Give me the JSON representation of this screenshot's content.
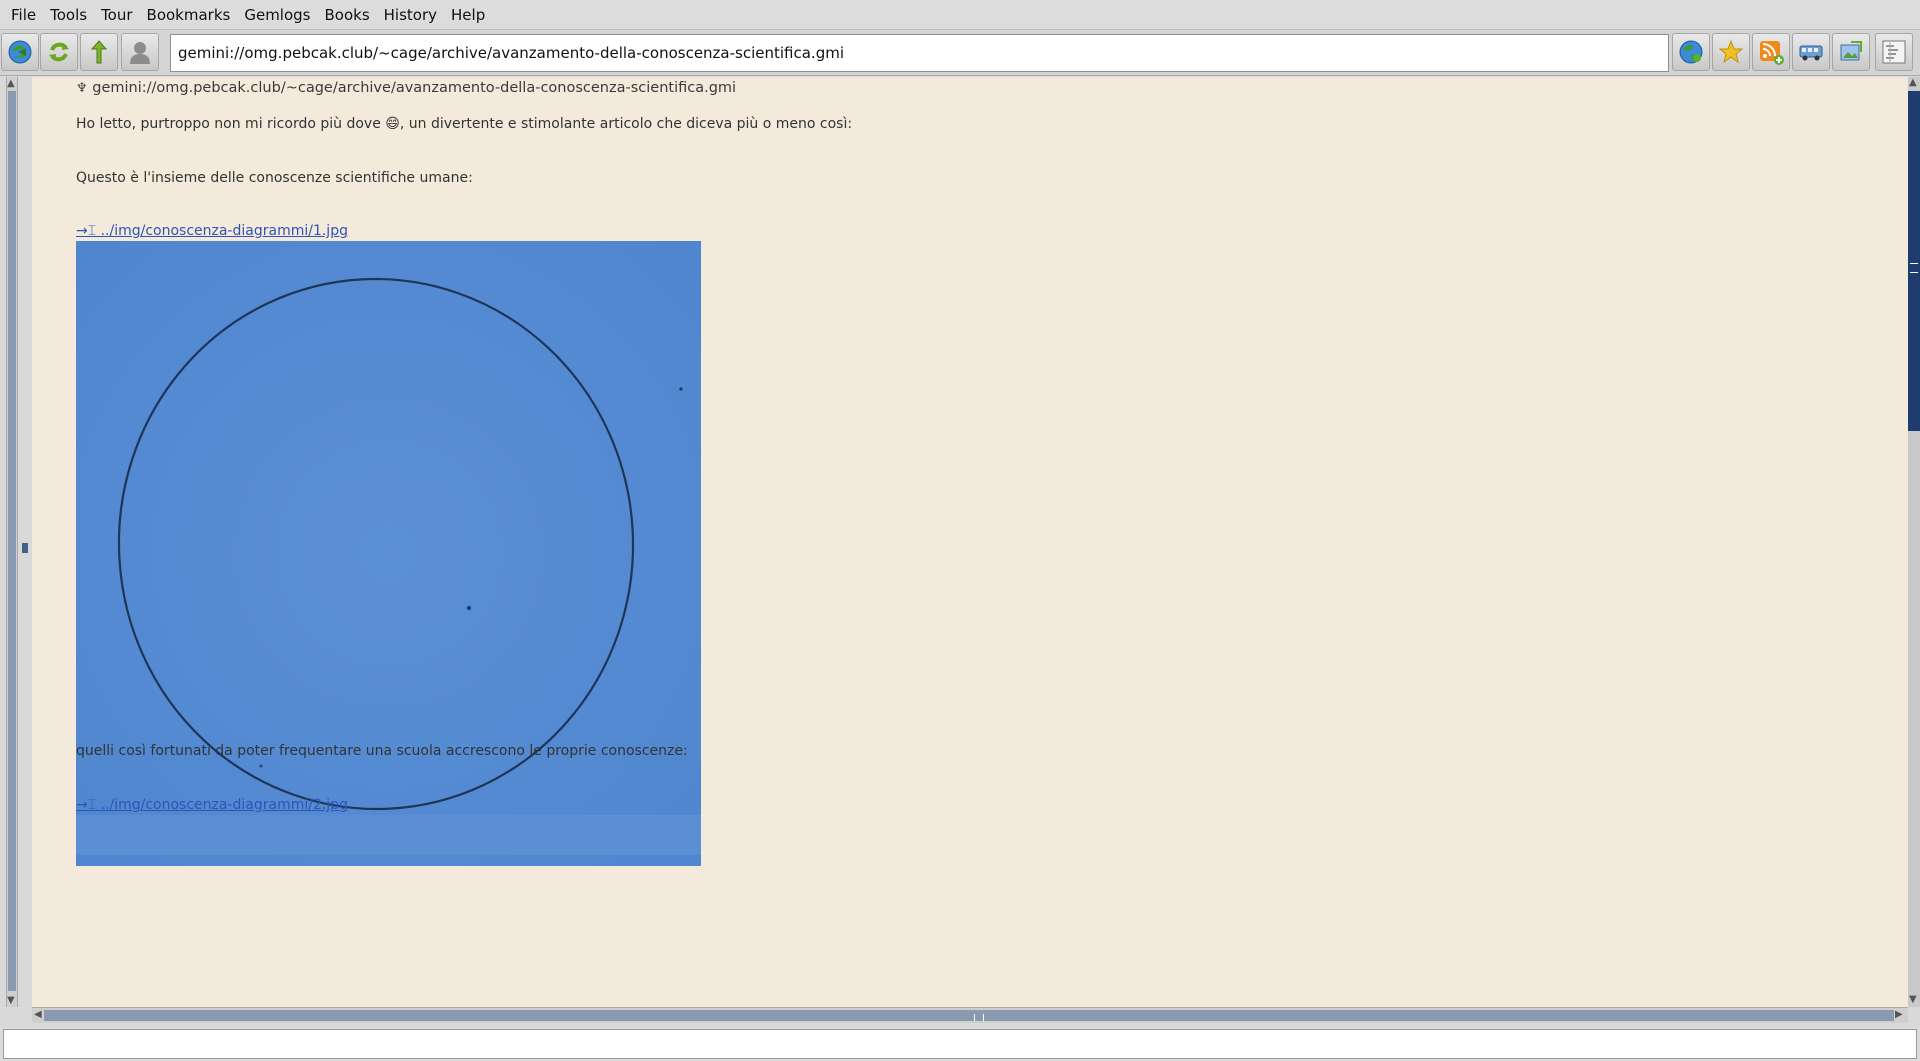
{
  "menu": [
    "File",
    "Tools",
    "Tour",
    "Bookmarks",
    "Gemlogs",
    "Books",
    "History",
    "Help"
  ],
  "toolbar": {
    "address": "gemini://omg.pebcak.club/~cage/archive/avanzamento-della-conoscenza-scientifica.gmi",
    "left_icons": [
      "back-icon",
      "reload-icon",
      "up-icon",
      "identity-icon"
    ],
    "right_icons": [
      "globe-icon",
      "bookmark-star-icon",
      "rss-add-icon",
      "tour-bus-icon",
      "image-preview-icon",
      "tree-view-icon"
    ]
  },
  "page": {
    "header_url": "gemini://omg.pebcak.club/~cage/archive/avanzamento-della-conoscenza-scientifica.gmi",
    "paragraph1": "Ho letto, purtroppo non mi ricordo più dove 😄, un divertente e stimolante articolo che diceva più o meno così:",
    "paragraph2": "Questo è l'insieme delle conoscenze scientifiche umane:",
    "link1": "→⌶ ../img/conoscenza-diagrammi/1.jpg",
    "paragraph3": "quelli così fortunati da poter frequentare una scuola accrescono le proprie conoscenze:",
    "link2": "→⌶ ../img/conoscenza-diagrammi/2.jpg"
  },
  "colors": {
    "page_background": "#f3eadb",
    "link": "#2c55b8",
    "image_blue": "#5a8fd3",
    "scroll_thumb": "#1e3d6e"
  }
}
